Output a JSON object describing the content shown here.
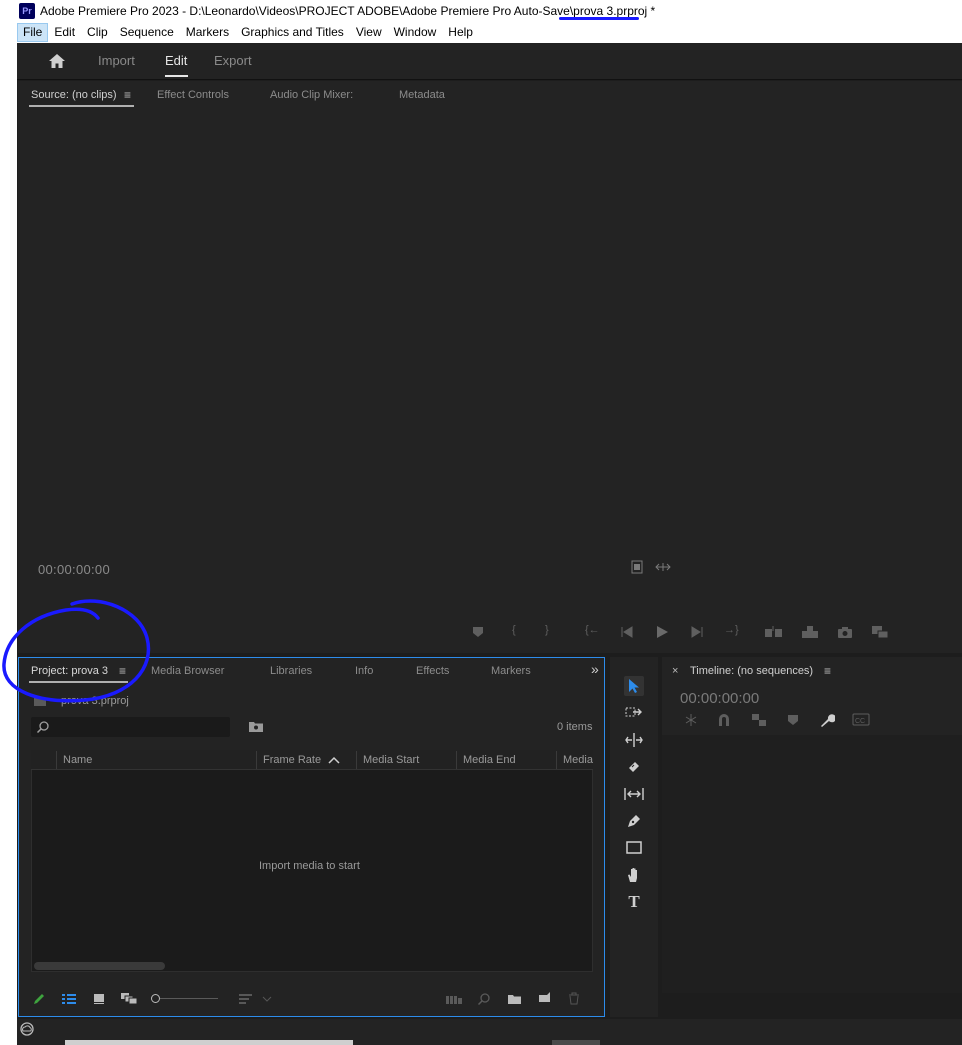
{
  "titlebar": {
    "logo": "Pr",
    "title": "Adobe Premiere Pro 2023 - D:\\Leonardo\\Videos\\PROJECT ADOBE\\Adobe Premiere Pro Auto-Save\\prova 3.prproj *"
  },
  "menu": [
    "File",
    "Edit",
    "Clip",
    "Sequence",
    "Markers",
    "Graphics and Titles",
    "View",
    "Window",
    "Help"
  ],
  "workspace": {
    "home_icon": "home-icon",
    "tabs": [
      "Import",
      "Edit",
      "Export"
    ],
    "active_tab": "Edit"
  },
  "source_panel": {
    "tabs": [
      "Source: (no clips)",
      "Effect Controls",
      "Audio Clip Mixer:",
      "Metadata"
    ],
    "menu_glyph": "≡",
    "timecode": "00:00:00:00"
  },
  "project_panel": {
    "tabs": [
      "Project: prova 3",
      "Media Browser",
      "Libraries",
      "Info",
      "Effects",
      "Markers"
    ],
    "overflow": "»",
    "menu_glyph": "≡",
    "project_file": "prova 3.prproj",
    "items_count": "0 items",
    "columns": [
      "Name",
      "Frame Rate",
      "Media Start",
      "Media End",
      "Media"
    ],
    "empty_message": "Import media to start"
  },
  "timeline_panel": {
    "close": "×",
    "title": "Timeline: (no sequences)",
    "menu_glyph": "≡",
    "timecode": "00:00:00:00"
  },
  "colors": {
    "accent": "#2d8ceb",
    "panel_bg": "#232323",
    "annotation": "#1a1aff"
  }
}
